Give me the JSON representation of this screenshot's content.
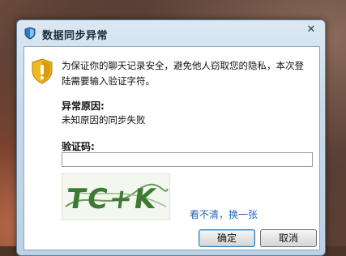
{
  "dialog": {
    "title": "数据同步异常",
    "close_glyph": "✕",
    "message": "为保证你的聊天记录安全，避免他人窃取您的隐私，本次登陆需要输入验证字符。",
    "reason_label": "异常原因:",
    "reason_value": "未知原因的同步失败",
    "code_label": "验证码:",
    "code_value": "",
    "captcha_text": "TC+K",
    "refresh_link": "看不清，换一张",
    "ok_label": "确定",
    "cancel_label": "取消"
  },
  "colors": {
    "link": "#1f66b3",
    "warning": "#f2b91d"
  },
  "icons": {
    "title": "shield-icon",
    "message": "warning-shield-icon"
  }
}
